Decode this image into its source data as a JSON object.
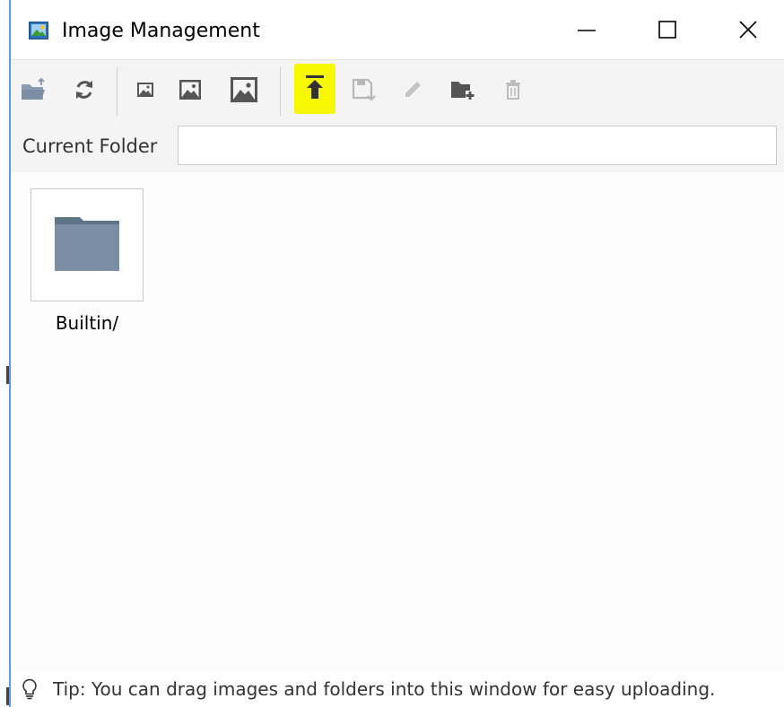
{
  "window": {
    "title": "Image Management",
    "controls": {
      "minimize": "minimize",
      "maximize": "maximize",
      "close": "close"
    }
  },
  "toolbar": {
    "buttons": [
      {
        "name": "open-folder",
        "icon": "folder-open-icon",
        "enabled": true
      },
      {
        "name": "refresh",
        "icon": "refresh-icon",
        "enabled": true
      },
      {
        "name": "small-thumbnails",
        "icon": "image-small-icon",
        "enabled": true
      },
      {
        "name": "medium-thumbnails",
        "icon": "image-medium-icon",
        "enabled": true
      },
      {
        "name": "large-thumbnails",
        "icon": "image-large-icon",
        "enabled": true
      },
      {
        "name": "upload",
        "icon": "upload-icon",
        "enabled": true,
        "highlighted": true
      },
      {
        "name": "download",
        "icon": "save-download-icon",
        "enabled": false
      },
      {
        "name": "rename",
        "icon": "pencil-icon",
        "enabled": false
      },
      {
        "name": "new-folder",
        "icon": "folder-add-icon",
        "enabled": true
      },
      {
        "name": "delete",
        "icon": "trash-icon",
        "enabled": false
      }
    ],
    "highlight_color": "#f7f700"
  },
  "current_folder": {
    "label": "Current Folder",
    "value": "",
    "placeholder": ""
  },
  "items": [
    {
      "label": "Builtin/",
      "type": "folder",
      "icon": "folder-icon"
    }
  ],
  "status": {
    "tip": "Tip: You can drag images and folders into this window for easy uploading."
  },
  "colors": {
    "folder_icon": "#7b8ea3",
    "window_border": "#5a9bd8",
    "toolbar_bg": "#f4f4f4"
  }
}
